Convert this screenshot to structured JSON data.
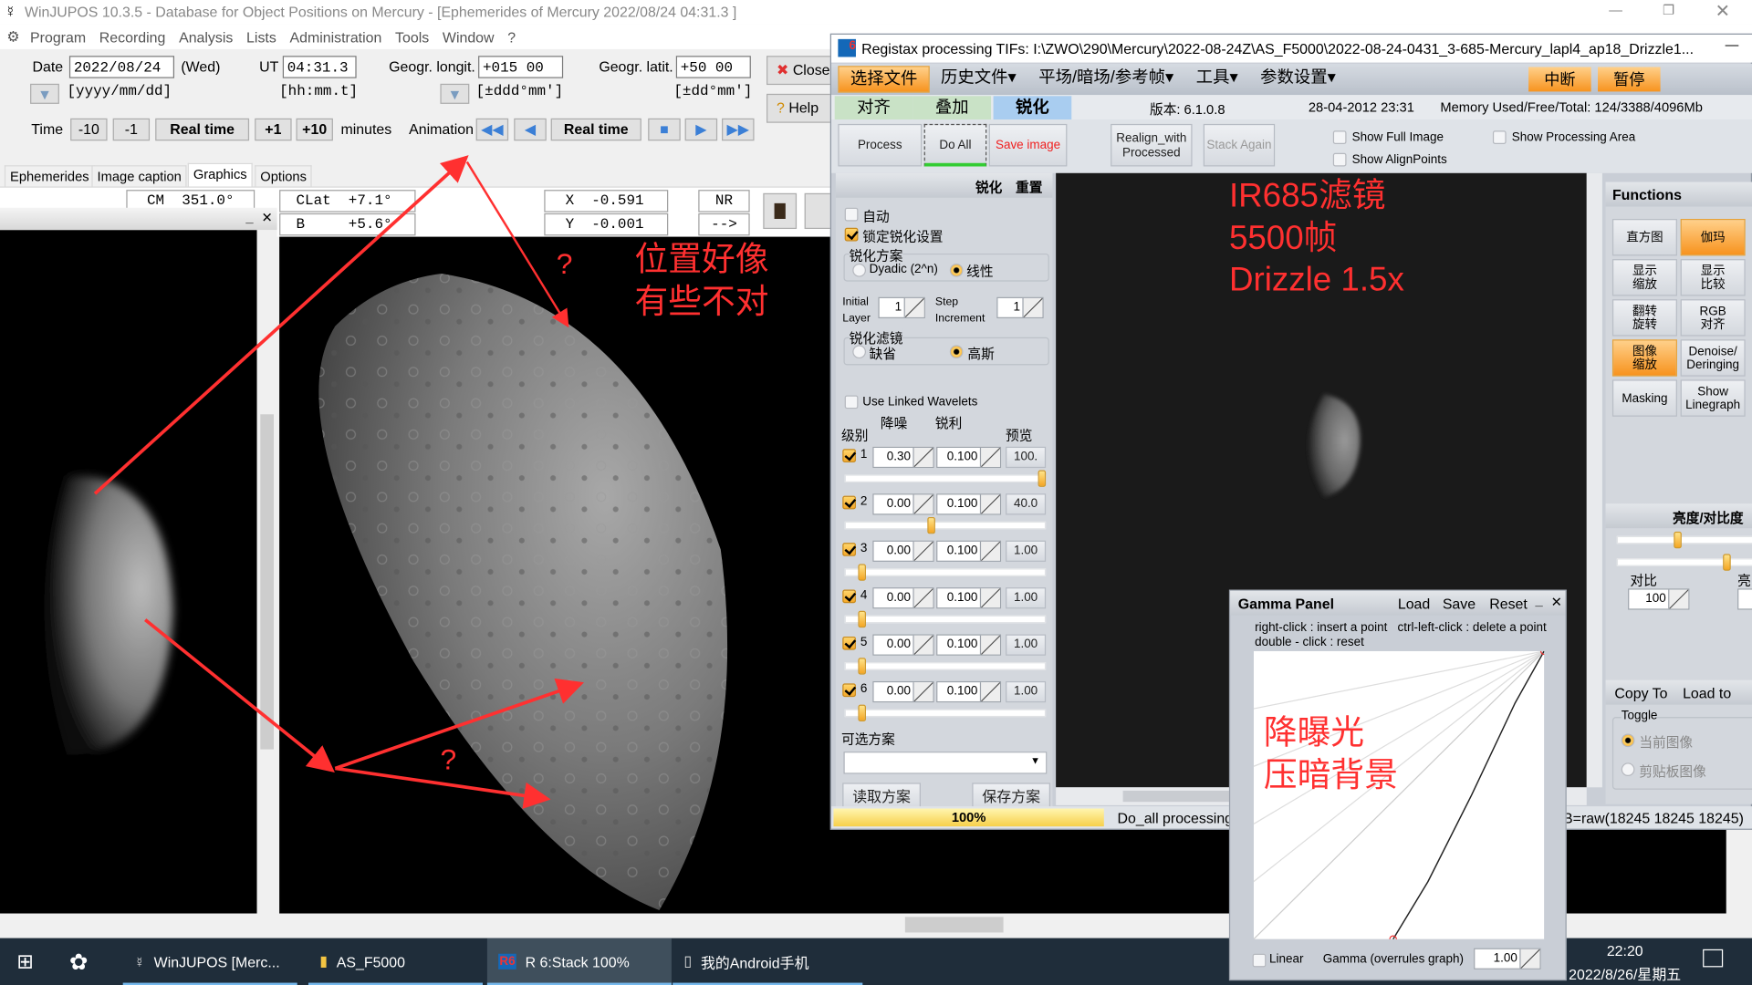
{
  "winjupos": {
    "title": "WinJUPOS 10.3.5 - Database for Object Positions on Mercury - [Ephemerides of Mercury  2022/08/24  04:31.3 ]",
    "menu": [
      "Program",
      "Recording",
      "Analysis",
      "Lists",
      "Administration",
      "Tools",
      "Window",
      "?"
    ],
    "date_label": "Date",
    "date_value": "2022/08/24",
    "weekday": "(Wed)",
    "date_format": "[yyyy/mm/dd]",
    "ut_label": "UT",
    "ut_value": "04:31.3",
    "ut_format": "[hh:mm.t]",
    "longit_label": "Geogr. longit.",
    "longit_value": "+015 00",
    "longit_format": "[±ddd°mm']",
    "latit_label": "Geogr. latit.",
    "latit_value": "+50 00",
    "latit_format": "[±dd°mm']",
    "close_label": "Close",
    "help_label": "Help",
    "time_label": "Time",
    "time_buttons": [
      "-10",
      "-1",
      "Real time",
      "+1",
      "+10"
    ],
    "minutes_label": "minutes",
    "animation_label": "Animation",
    "animation_realtime": "Real time",
    "tabs": [
      "Ephemerides",
      "Image caption",
      "Graphics",
      "Options"
    ],
    "active_tab": "Graphics",
    "cm": "CM  351.0°",
    "clat": "CLat  +7.1°",
    "b": "B     +5.6°",
    "x": "X  -0.591",
    "y": "Y  -0.001",
    "nr": "NR",
    "arrow": "-->"
  },
  "registax": {
    "title": "Registax processing TIFs: I:\\ZWO\\290\\Mercury\\2022-08-24Z\\AS_F5000\\2022-08-24-0431_3-685-Mercury_lapl4_ap18_Drizzle1...",
    "menu": [
      "选择文件",
      "历史文件▾",
      "平场/暗场/参考帧▾",
      "工具▾",
      "参数设置▾"
    ],
    "stop": "中断",
    "pause": "暂停",
    "tabs": [
      "对齐",
      "叠加",
      "锐化"
    ],
    "active_tab": "锐化",
    "version": "版本: 6.1.0.8",
    "build_date": "28-04-2012 23:31",
    "memory": "Memory Used/Free/Total: 124/3388/4096Mb",
    "buttons": {
      "process": "Process",
      "do_all": "Do All",
      "save_image": "Save image",
      "realign": "Realign_with Processed",
      "stack_again": "Stack Again"
    },
    "show_full_image": "Show Full Image",
    "show_align_points": "Show AlignPoints",
    "show_processing_area": "Show Processing Area",
    "panel": {
      "header_sharpen": "锐化",
      "header_reset": "重置",
      "auto": "自动",
      "auto_checked": false,
      "lock": "锁定锐化设置",
      "lock_checked": true,
      "scheme_label": "锐化方案",
      "scheme_dyadic": "Dyadic (2^n)",
      "scheme_linear": "线性",
      "scheme_selected": "线性",
      "initial_layer_label": "Initial Layer",
      "initial_layer": "1",
      "step_label": "Step Increment",
      "step": "1",
      "filter_label": "锐化滤镜",
      "filter_default": "缺省",
      "filter_gauss": "高斯",
      "filter_selected": "高斯",
      "linked": "Use Linked Wavelets",
      "linked_checked": false,
      "col_level": "级别",
      "col_denoise": "降噪",
      "col_sharpen": "锐利",
      "col_preview": "预览",
      "layers": [
        {
          "n": "1",
          "checked": true,
          "denoise": "0.30",
          "sharpen": "0.100",
          "preview": "100.",
          "slider": 1.0
        },
        {
          "n": "2",
          "checked": true,
          "denoise": "0.00",
          "sharpen": "0.100",
          "preview": "40.0",
          "slider": 0.43
        },
        {
          "n": "3",
          "checked": true,
          "denoise": "0.00",
          "sharpen": "0.100",
          "preview": "1.00",
          "slider": 0.07
        },
        {
          "n": "4",
          "checked": true,
          "denoise": "0.00",
          "sharpen": "0.100",
          "preview": "1.00",
          "slider": 0.07
        },
        {
          "n": "5",
          "checked": true,
          "denoise": "0.00",
          "sharpen": "0.100",
          "preview": "1.00",
          "slider": 0.07
        },
        {
          "n": "6",
          "checked": true,
          "denoise": "0.00",
          "sharpen": "0.100",
          "preview": "1.00",
          "slider": 0.07
        }
      ],
      "preset_label": "可选方案",
      "preset_value": "",
      "load_preset": "读取方案",
      "save_preset": "保存方案"
    },
    "functions": {
      "title": "Functions",
      "buttons": [
        {
          "label": "直方图",
          "active": false
        },
        {
          "label": "伽玛",
          "active": true
        },
        {
          "label": "显示\n缩放",
          "active": false
        },
        {
          "label": "显示\n比较",
          "active": false
        },
        {
          "label": "翻转\n旋转",
          "active": false
        },
        {
          "label": "RGB\n对齐",
          "active": false
        },
        {
          "label": "图像\n缩放",
          "active": true
        },
        {
          "label": "Denoise/\nDeringing",
          "active": false
        },
        {
          "label": "Masking",
          "active": false
        },
        {
          "label": "Show\nLinegraph",
          "active": false
        }
      ],
      "brightness_title": "亮度/对比度",
      "contrast_label": "对比",
      "contrast_value": "100",
      "brightness_label": "亮",
      "brightness_slider": 0.4,
      "contrast_slider": 0.75,
      "copy_to": "Copy To",
      "load_to": "Load to",
      "toggle_label": "Toggle",
      "toggle_current": "当前图像",
      "toggle_clipboard": "剪贴板图像",
      "toggle_selected": "当前图像"
    },
    "status": {
      "progress": "100%",
      "progress_value": 100,
      "message": "Do_all processing",
      "pixel": "B=raw(18245 18245 18245)"
    }
  },
  "gamma": {
    "title": "Gamma Panel",
    "load": "Load",
    "save": "Save",
    "reset": "Reset",
    "help1": "right-click : insert a point   ctrl-left-click : delete a point",
    "help2": "double - click : reset",
    "linear": "Linear",
    "linear_checked": false,
    "gamma_label": "Gamma (overrules graph)",
    "gamma_value": "1.00",
    "curve_points": [
      [
        0.48,
        0
      ],
      [
        0.6,
        0.2
      ],
      [
        0.75,
        0.5
      ],
      [
        0.9,
        0.82
      ],
      [
        1,
        1
      ]
    ]
  },
  "annotations": {
    "position_wrong": "位置好像\n有些不对",
    "question1": "?",
    "question2": "?",
    "filter_note": "IR685滤镜\n5500帧\nDrizzle 1.5x",
    "gamma_note": "降曝光\n压暗背景",
    "color": "#ff3030"
  },
  "taskbar": {
    "items": [
      "WinJUPOS [Merc...",
      "AS_F5000",
      "R 6:Stack 100%",
      "我的Android手机"
    ],
    "active": "R 6:Stack 100%",
    "time": "22:20",
    "date": "2022/8/26/星期五"
  }
}
